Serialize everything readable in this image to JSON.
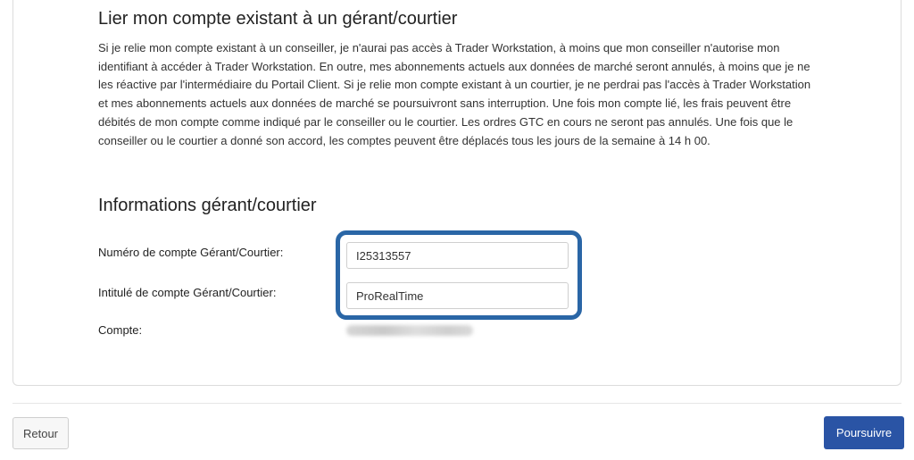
{
  "link_section": {
    "title": "Lier mon compte existant à un gérant/courtier",
    "description": "Si je relie mon compte existant à un conseiller, je n'aurai pas accès à Trader Workstation, à moins que mon conseiller n'autorise mon identifiant à accéder à Trader Workstation. En outre, mes abonnements actuels aux données de marché seront annulés, à moins que je ne les réactive par l'intermédiaire du Portail Client. Si je relie mon compte existant à un courtier, je ne perdrai pas l'accès à Trader Workstation et mes abonnements actuels aux données de marché se poursuivront sans interruption. Une fois mon compte lié, les frais peuvent être débités de mon compte comme indiqué par le conseiller ou le courtier. Les ordres GTC en cours ne seront pas annulés. Une fois que le conseiller ou le courtier a donné son accord, les comptes peuvent être déplacés tous les jours de la semaine à 14 h 00."
  },
  "info_section": {
    "title": "Informations gérant/courtier",
    "account_number_label": "Numéro de compte Gérant/Courtier:",
    "account_number_value": "I25313557",
    "account_name_label": "Intitulé de compte Gérant/Courtier:",
    "account_name_value": "ProRealTime",
    "account_label": "Compte:"
  },
  "footer": {
    "back_label": "Retour",
    "continue_label": "Poursuivre"
  },
  "colors": {
    "highlight_border": "#2a66a6",
    "primary_button": "#2a54a5"
  }
}
